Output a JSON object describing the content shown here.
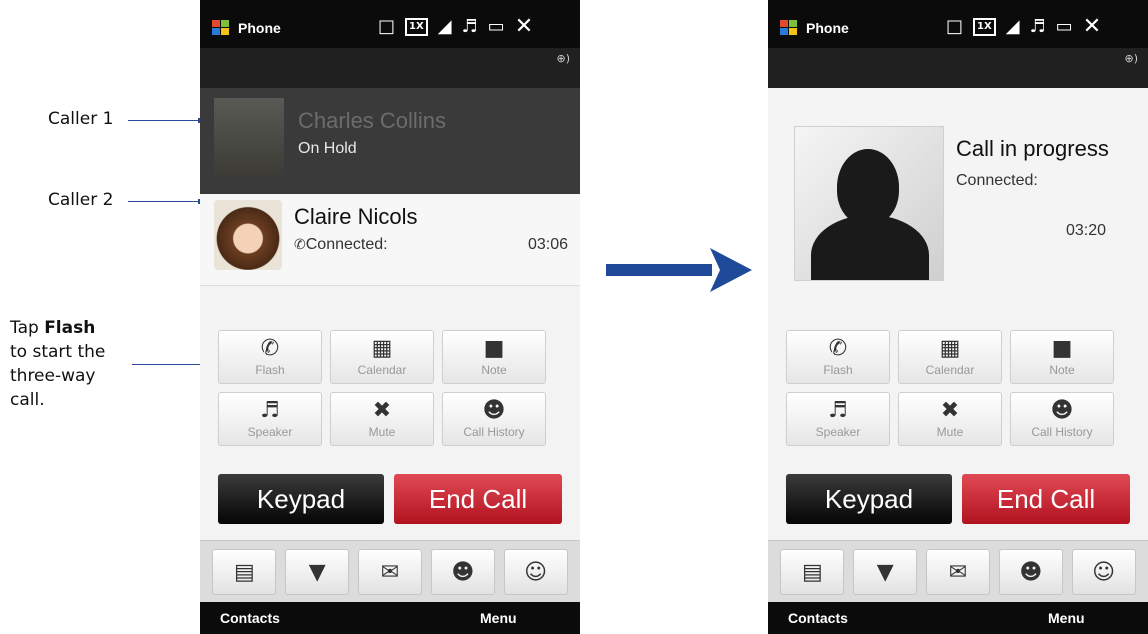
{
  "annotations": {
    "caller1": "Caller 1",
    "caller2": "Caller 2",
    "tap_prefix": "Tap ",
    "tap_bold": "Flash",
    "line2": "to start the",
    "line3": "three-way",
    "line4": "call."
  },
  "phone": {
    "app_title": "Phone",
    "status_icons": [
      "tv-icon",
      "1x-icon",
      "signal-icon",
      "speaker-icon",
      "battery-icon",
      "close-icon"
    ],
    "bt_icon": "bluetooth-icon",
    "softkey_left": "Contacts",
    "softkey_right": "Menu",
    "functions": [
      {
        "label": "Flash",
        "icon": "flash-icon"
      },
      {
        "label": "Calendar",
        "icon": "calendar-icon"
      },
      {
        "label": "Note",
        "icon": "note-icon"
      },
      {
        "label": "Speaker",
        "icon": "speaker-icon"
      },
      {
        "label": "Mute",
        "icon": "mute-icon"
      },
      {
        "label": "Call History",
        "icon": "call-history-icon"
      }
    ],
    "keypad": "Keypad",
    "end_call": "End Call",
    "tray_icons": [
      "contact-card-icon",
      "message-icon",
      "email-icon",
      "call-log-icon",
      "contacts-icon"
    ]
  },
  "left_screen": {
    "caller1": {
      "name": "Charles Collins",
      "status": "On Hold"
    },
    "caller2": {
      "name": "Claire Nicols",
      "status": "Connected:",
      "time": "03:06"
    }
  },
  "right_screen": {
    "title": "Call in progress",
    "status": "Connected:",
    "time": "03:20"
  },
  "colors": {
    "accent_arrow": "#1f4a99",
    "end_call": "#c8202d",
    "status_bar": "#0b0b0b"
  }
}
